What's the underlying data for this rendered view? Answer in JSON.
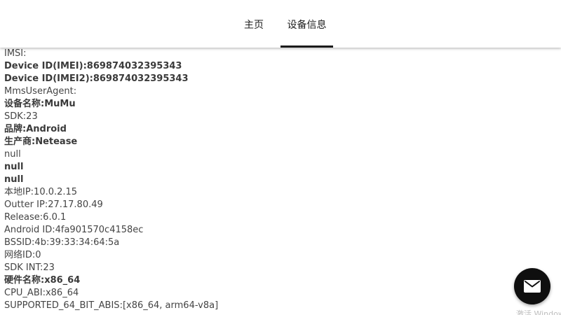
{
  "tabs": {
    "home": "主页",
    "device_info": "设备信息"
  },
  "info_lines": [
    {
      "text": "IMSI:",
      "bold": false
    },
    {
      "text": "Device ID(IMEI):869874032395343",
      "bold": true
    },
    {
      "text": "Device ID(IMEI2):869874032395343",
      "bold": true
    },
    {
      "text": "MmsUserAgent:",
      "bold": false
    },
    {
      "text": "设备名称:MuMu",
      "bold": true
    },
    {
      "text": "SDK:23",
      "bold": false
    },
    {
      "text": "品牌:Android",
      "bold": true
    },
    {
      "text": "生产商:Netease",
      "bold": true
    },
    {
      "text": "null",
      "bold": false
    },
    {
      "text": "null",
      "bold": true
    },
    {
      "text": "null",
      "bold": true
    },
    {
      "text": "本地IP:10.0.2.15",
      "bold": false
    },
    {
      "text": "Outter IP:27.17.80.49",
      "bold": false
    },
    {
      "text": "Release:6.0.1",
      "bold": false
    },
    {
      "text": "Android ID:4fa901570c4158ec",
      "bold": false
    },
    {
      "text": "BSSID:4b:39:33:34:64:5a",
      "bold": false
    },
    {
      "text": "网络ID:0",
      "bold": false
    },
    {
      "text": "SDK INT:23",
      "bold": false
    },
    {
      "text": "硬件名称:x86_64",
      "bold": true
    },
    {
      "text": "CPU_ABI:x86_64",
      "bold": false
    },
    {
      "text": "SUPPORTED_64_BIT_ABIS:[x86_64, arm64-v8a]",
      "bold": false
    }
  ],
  "fab": {
    "icon": "mail-icon",
    "color": "#0f0f0f"
  },
  "watermark": "激活 Windows"
}
